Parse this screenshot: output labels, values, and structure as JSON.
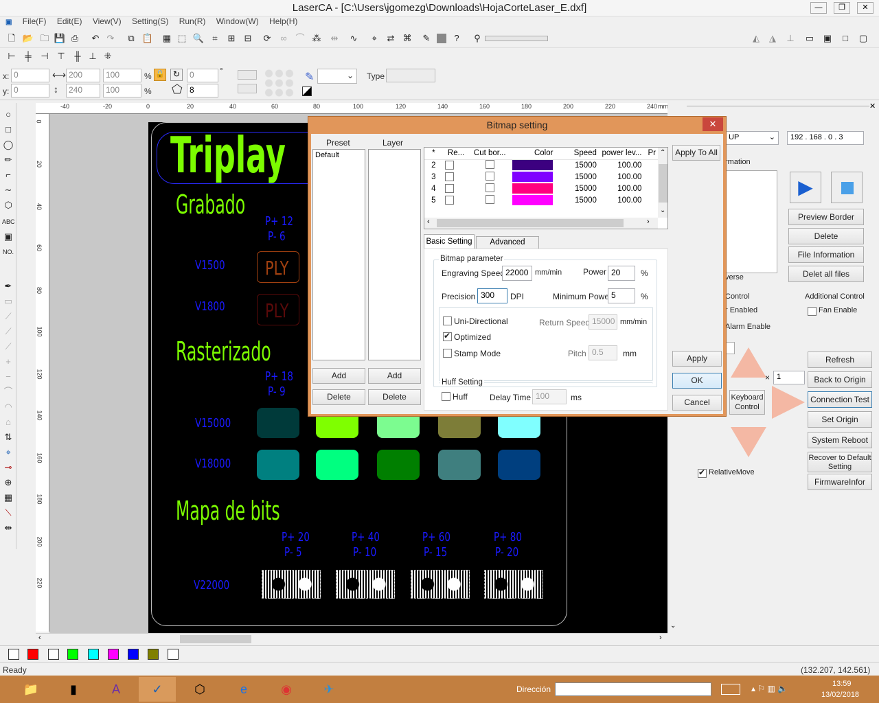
{
  "window": {
    "title": "LaserCA - [C:\\Users\\jgomezg\\Downloads\\HojaCorteLaser_E.dxf]"
  },
  "menu": [
    "File(F)",
    "Edit(E)",
    "View(V)",
    "Setting(S)",
    "Run(R)",
    "Window(W)",
    "Help(H)"
  ],
  "props": {
    "x_label": "x:",
    "y_label": "y:",
    "x": "0",
    "y": "0",
    "w": "200",
    "h": "240",
    "wp": "100",
    "hp": "100",
    "pct": "%",
    "angle": "0",
    "deg": "°",
    "sides": "8",
    "type_label": "Type"
  },
  "ruler": {
    "top": [
      "-40",
      "-20",
      "0",
      "20",
      "40",
      "60",
      "80",
      "100",
      "120",
      "140",
      "160",
      "180",
      "200",
      "220",
      "240",
      "mm"
    ],
    "left": [
      "0",
      "20",
      "40",
      "60",
      "80",
      "100",
      "120",
      "140",
      "160",
      "180",
      "200",
      "220"
    ]
  },
  "lefttools": {
    "abc": "ABC",
    "no": "NO."
  },
  "design": {
    "title": "Triplay",
    "grabado": "Grabado",
    "grabado_pp": [
      "P+ 12",
      "P- 6"
    ],
    "grabado_rows": [
      {
        "v": "V1500",
        "ply": "PLY"
      },
      {
        "v": "V1800",
        "ply": "PLY"
      }
    ],
    "rasterizado": "Rasterizado",
    "raster_pp": [
      "P+ 18",
      "P- 9"
    ],
    "raster_v": [
      "V15000",
      "V18000"
    ],
    "mapa": "Mapa de bits",
    "mapa_pp": [
      [
        "P+ 20",
        "P- 5"
      ],
      [
        "P+ 40",
        "P- 10"
      ],
      [
        "P+ 60",
        "P- 15"
      ],
      [
        "P+ 80",
        "P- 20"
      ]
    ],
    "mapa_v": "V22000",
    "swatches_row1": [
      "#003a3a",
      "#7fff00",
      "#7cfc90",
      "#7d7d38",
      "#80ffff"
    ],
    "swatches_row2": [
      "#008080",
      "#00ff80",
      "#007f00",
      "#3f7f7f",
      "#003f7f"
    ]
  },
  "dialog": {
    "title": "Bitmap setting",
    "preset_header": "Preset",
    "layer_header": "Layer",
    "preset_items": [
      "Default"
    ],
    "add": "Add",
    "delete": "Delete",
    "apply_to_all": "Apply To All",
    "columns": [
      "*",
      "Re...",
      "Cut bor...",
      "Color",
      "Speed",
      "power lev...",
      "Pr"
    ],
    "rows": [
      {
        "n": "2",
        "color": "#3c0080",
        "speed": "15000",
        "power": "100.00"
      },
      {
        "n": "3",
        "color": "#8000ff",
        "speed": "15000",
        "power": "100.00"
      },
      {
        "n": "4",
        "color": "#ff0080",
        "speed": "15000",
        "power": "100.00"
      },
      {
        "n": "5",
        "color": "#ff00ff",
        "speed": "15000",
        "power": "100.00"
      }
    ],
    "tabs": [
      "Basic Setting",
      "Advanced Setting"
    ],
    "bitmap_param": "Bitmap parameter",
    "engraving_speed_label": "Engraving Speed",
    "engraving_speed": "22000",
    "mmmin": "mm/min",
    "power_label": "Power",
    "power": "20",
    "pct": "%",
    "precision_label": "Precision",
    "precision": "300",
    "dpi": "DPI",
    "min_power_label": "Minimum Power",
    "min_power": "5",
    "uni": "Uni-Directional",
    "optimized": "Optimized",
    "stamp": "Stamp Mode",
    "return_speed_label": "Return Speed",
    "return_speed": "15000",
    "pitch_label": "Pitch",
    "pitch": "0.5",
    "mm": "mm",
    "huff_setting": "Huff Setting",
    "huff": "Huff",
    "delay_label": "Delay Time",
    "delay": "100",
    "ms": "ms",
    "apply": "Apply",
    "ok": "OK",
    "cancel": "Cancel"
  },
  "rpanel": {
    "ip_prefix": "UP",
    "ip": "192 . 168 .  0  .  3",
    "information": "rmation",
    "preview_border": "Preview Border",
    "delete": "Delete",
    "file_info": "File Information",
    "delete_all": "Delet all files",
    "reverse": "verse",
    "control": "Control",
    "r_enabled": "r Enabled",
    "alarm": "Alarm Enable",
    "additional": "Additional Control",
    "fan": "Fan Enable",
    "refresh": "Refresh",
    "back_origin": "Back to Origin",
    "conn_test": "Connection Test",
    "set_origin": "Set Origin",
    "reboot": "System Reboot",
    "recover": "Recover to Default Setting",
    "firmware": "FirmwareInfor",
    "keyboard": "Keyboard Control",
    "times": "×",
    "step": "1",
    "relative": "RelativeMove"
  },
  "status": {
    "ready": "Ready",
    "coords": "(132.207, 142.561)"
  },
  "taskbar": {
    "direccion": "Dirección",
    "time": "13:59",
    "date": "13/02/2018"
  },
  "colors": {
    "design_green": "#7cfc00",
    "design_blue": "#1a1aff",
    "dialog_frame": "#e1965a",
    "taskbar": "#c27f40"
  },
  "palette": [
    "#ffffff",
    "#ff0000",
    "#ffffff",
    "#00ff00",
    "#00ffff",
    "#ff00ff",
    "#0000ff",
    "#808000",
    "#ffffff"
  ]
}
